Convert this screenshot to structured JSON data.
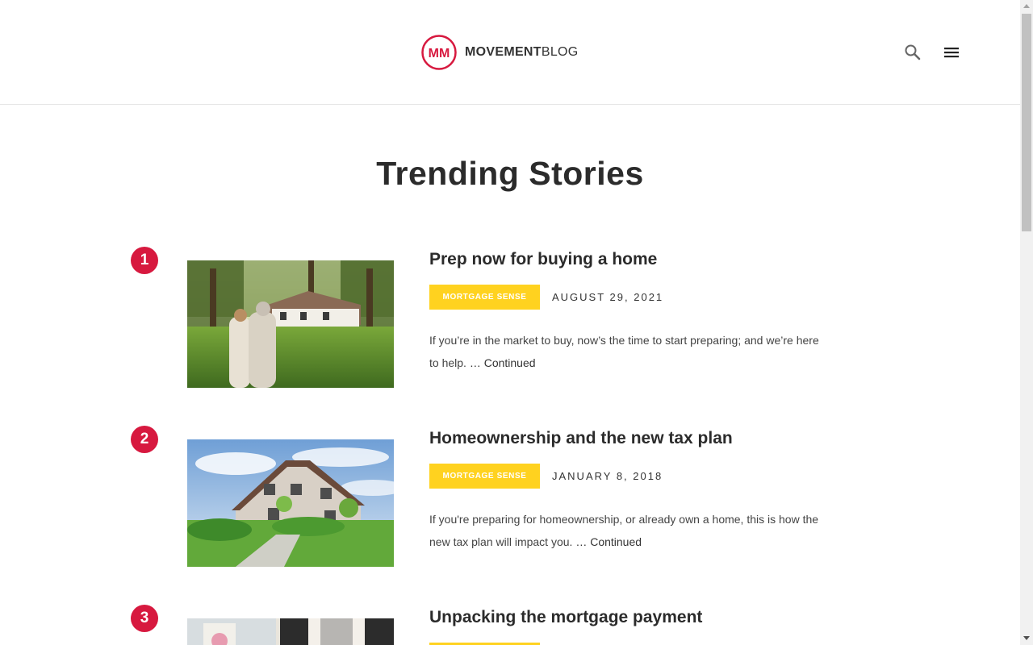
{
  "header": {
    "logo_monogram": "MM",
    "logo_bold": "MOVEMENT",
    "logo_light": "BLOG",
    "search_icon": "search-icon",
    "menu_icon": "hamburger-menu-icon"
  },
  "colors": {
    "brand_red": "#d7193f",
    "tag_yellow": "#ffd21f",
    "text_dark": "#2b2b2b"
  },
  "section": {
    "title": "Trending Stories"
  },
  "stories": [
    {
      "rank": "1",
      "title": "Prep now for buying a home",
      "tag": "MORTGAGE SENSE",
      "date": "AUGUST 29, 2021",
      "excerpt": "If you’re in the market to buy, now’s the time to start preparing; and we’re here to help.",
      "more": "… Continued",
      "image": "couple looking at house"
    },
    {
      "rank": "2",
      "title": "Homeownership and the new tax plan",
      "tag": "MORTGAGE SENSE",
      "date": "JANUARY 8, 2018",
      "excerpt": "If you're preparing for homeownership, or already own a home, this is how the new tax plan will impact you.",
      "more": "… Continued",
      "image": "two-story house with garden"
    },
    {
      "rank": "3",
      "title": "Unpacking the mortgage payment",
      "tag": "",
      "date": "",
      "excerpt": "",
      "more": "",
      "image": "person in front of house"
    }
  ]
}
